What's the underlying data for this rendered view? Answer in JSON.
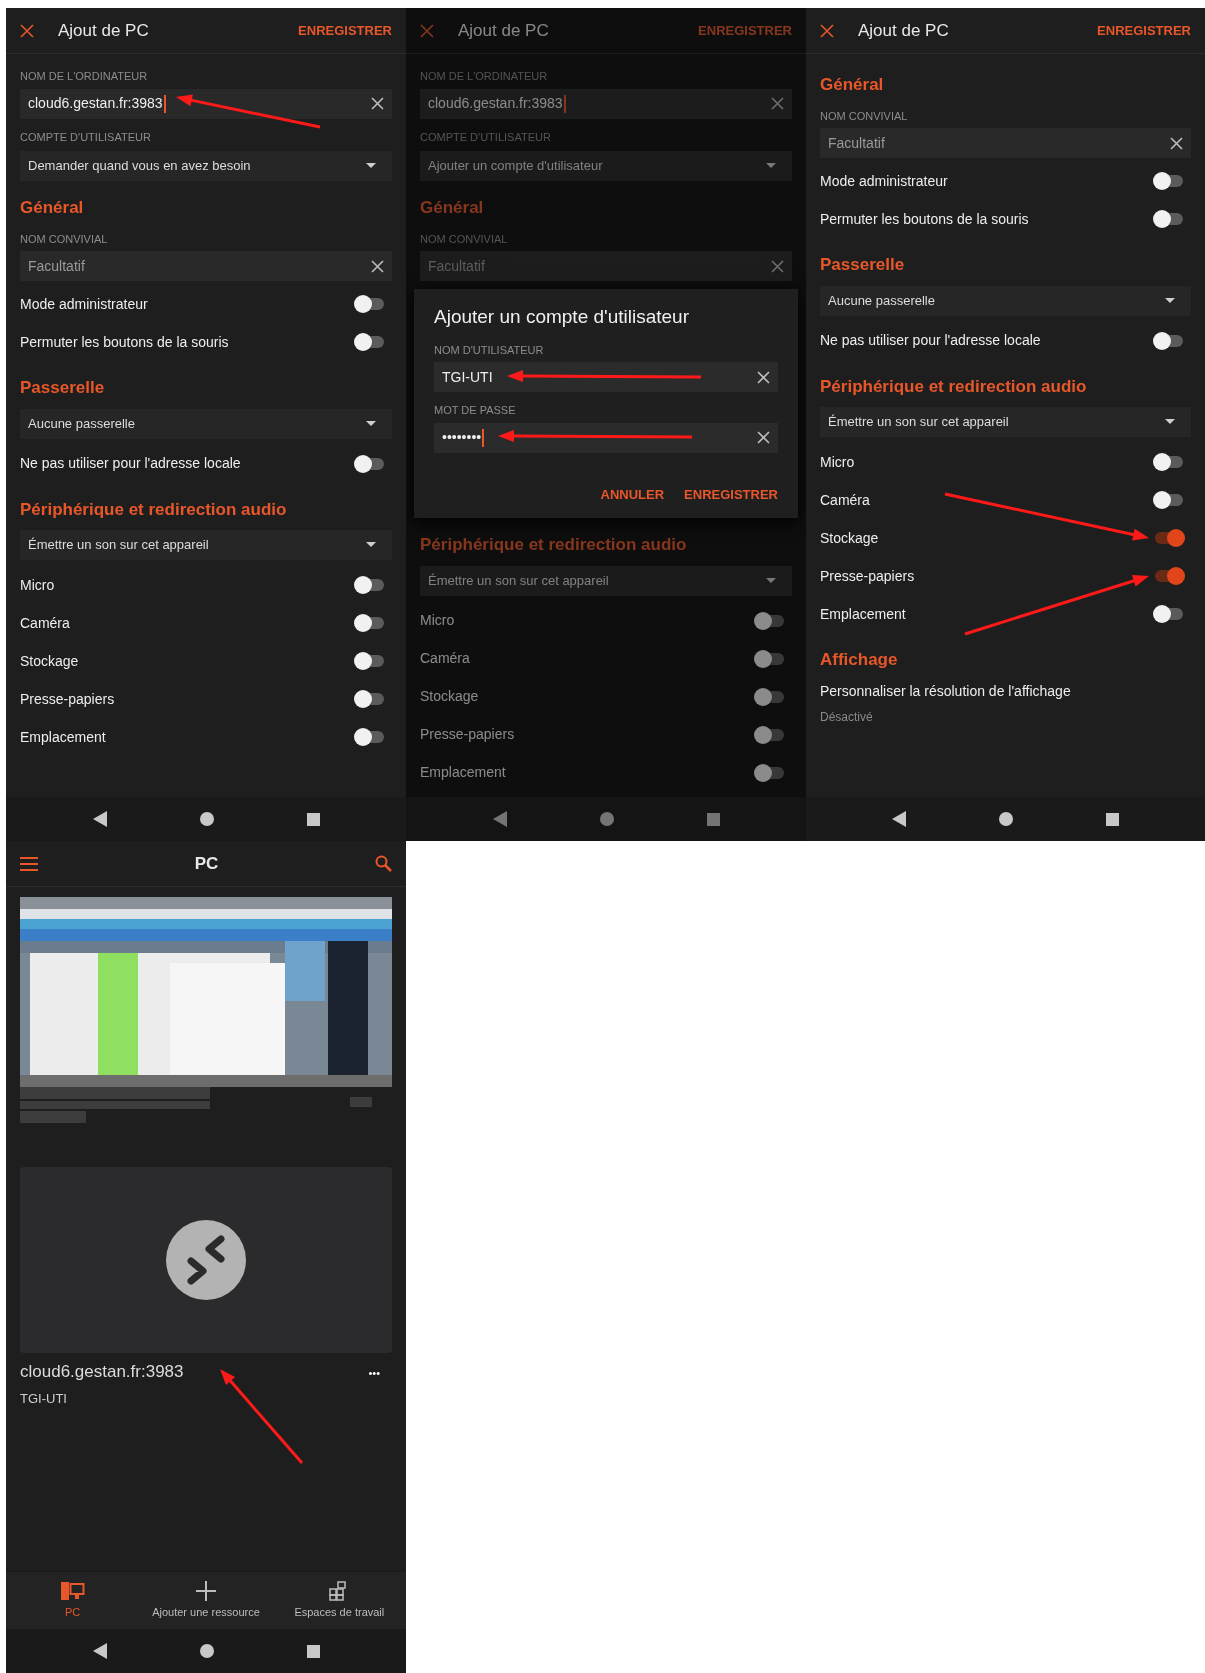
{
  "screens": [
    {
      "kind": "settings",
      "dimmed": false,
      "title": "Ajout de PC",
      "action": "ENREGISTRER",
      "items": [
        {
          "kind": "label",
          "text": "NOM DE L'ORDINATEUR"
        },
        {
          "kind": "field",
          "value": "cloud6.gestan.fr:3983",
          "focused": true,
          "arrow": true
        },
        {
          "kind": "label",
          "text": "COMPTE D'UTILISATEUR"
        },
        {
          "kind": "dropdown",
          "value": "Demander quand vous en avez besoin"
        },
        {
          "kind": "section",
          "text": "Général"
        },
        {
          "kind": "label",
          "text": "NOM CONVIVIAL"
        },
        {
          "kind": "field",
          "placeholder": "Facultatif",
          "focused": false
        },
        {
          "kind": "toggle",
          "text": "Mode administrateur",
          "on": false
        },
        {
          "kind": "toggle",
          "text": "Permuter les boutons de la souris",
          "on": false
        },
        {
          "kind": "section",
          "text": "Passerelle"
        },
        {
          "kind": "dropdown",
          "value": "Aucune passerelle"
        },
        {
          "kind": "toggle",
          "text": "Ne pas utiliser pour l'adresse locale",
          "on": false
        },
        {
          "kind": "section",
          "text": "Périphérique et redirection audio"
        },
        {
          "kind": "dropdown",
          "value": "Émettre un son sur cet appareil"
        },
        {
          "kind": "toggle",
          "text": "Micro",
          "on": false
        },
        {
          "kind": "toggle",
          "text": "Caméra",
          "on": false
        },
        {
          "kind": "toggle",
          "text": "Stockage",
          "on": false
        },
        {
          "kind": "toggle",
          "text": "Presse-papiers",
          "on": false
        },
        {
          "kind": "toggle",
          "text": "Emplacement",
          "on": false
        }
      ]
    },
    {
      "kind": "settings",
      "dimmed": true,
      "title": "Ajout de PC",
      "action": "ENREGISTRER",
      "items": [
        {
          "kind": "label",
          "text": "NOM DE L'ORDINATEUR"
        },
        {
          "kind": "field",
          "value": "cloud6.gestan.fr:3983",
          "focused": true
        },
        {
          "kind": "label",
          "text": "COMPTE D'UTILISATEUR"
        },
        {
          "kind": "dropdown",
          "value": "Ajouter un compte d'utilisateur"
        },
        {
          "kind": "section",
          "text": "Général"
        },
        {
          "kind": "label",
          "text": "NOM CONVIVIAL"
        },
        {
          "kind": "field",
          "placeholder": "Facultatif",
          "focused": false
        },
        {
          "kind": "dialog",
          "title": "Ajouter un compte d'utilisateur",
          "fields": [
            {
              "label": "NOM D'UTILISATEUR",
              "value": "TGI-UTI",
              "focused": false,
              "arrow": true
            },
            {
              "label": "MOT DE PASSE",
              "value": "••••••••",
              "focused": true,
              "arrow": true
            }
          ],
          "buttons": [
            "ANNULER",
            "ENREGISTRER"
          ]
        },
        {
          "kind": "section",
          "text": "Périphérique et redirection audio"
        },
        {
          "kind": "dropdown",
          "value": "Émettre un son sur cet appareil"
        },
        {
          "kind": "toggle",
          "text": "Micro",
          "on": false
        },
        {
          "kind": "toggle",
          "text": "Caméra",
          "on": false
        },
        {
          "kind": "toggle",
          "text": "Stockage",
          "on": false
        },
        {
          "kind": "toggle",
          "text": "Presse-papiers",
          "on": false
        },
        {
          "kind": "toggle",
          "text": "Emplacement",
          "on": false
        }
      ]
    },
    {
      "kind": "settings",
      "dimmed": false,
      "title": "Ajout de PC",
      "action": "ENREGISTRER",
      "items": [
        {
          "kind": "section",
          "text": "Général"
        },
        {
          "kind": "label",
          "text": "NOM CONVIVIAL"
        },
        {
          "kind": "field",
          "placeholder": "Facultatif",
          "focused": false
        },
        {
          "kind": "toggle",
          "text": "Mode administrateur",
          "on": false
        },
        {
          "kind": "toggle",
          "text": "Permuter les boutons de la souris",
          "on": false
        },
        {
          "kind": "section",
          "text": "Passerelle"
        },
        {
          "kind": "dropdown",
          "value": "Aucune passerelle"
        },
        {
          "kind": "toggle",
          "text": "Ne pas utiliser pour l'adresse locale",
          "on": false
        },
        {
          "kind": "section",
          "text": "Périphérique et redirection audio"
        },
        {
          "kind": "dropdown",
          "value": "Émettre un son sur cet appareil"
        },
        {
          "kind": "toggle",
          "text": "Micro",
          "on": false
        },
        {
          "kind": "toggle",
          "text": "Caméra",
          "on": false
        },
        {
          "kind": "toggle",
          "text": "Stockage",
          "on": true,
          "arrow": true
        },
        {
          "kind": "toggle",
          "text": "Presse-papiers",
          "on": true,
          "arrow": true
        },
        {
          "kind": "toggle",
          "text": "Emplacement",
          "on": false
        },
        {
          "kind": "section",
          "text": "Affichage"
        },
        {
          "kind": "setting",
          "text": "Personnaliser la résolution de l'affichage",
          "value": "Désactivé"
        }
      ]
    },
    {
      "kind": "home",
      "title": "PC",
      "connection": {
        "name": "cloud6.gestan.fr:3983",
        "user": "TGI-UTI",
        "more": "•••",
        "arrow": true
      },
      "tabs": [
        {
          "label": "PC",
          "kind": "pc",
          "selected": true
        },
        {
          "label": "Ajouter une ressource",
          "kind": "plus",
          "selected": false
        },
        {
          "label": "Espaces de travail",
          "kind": "workspaces",
          "selected": false
        }
      ]
    }
  ]
}
